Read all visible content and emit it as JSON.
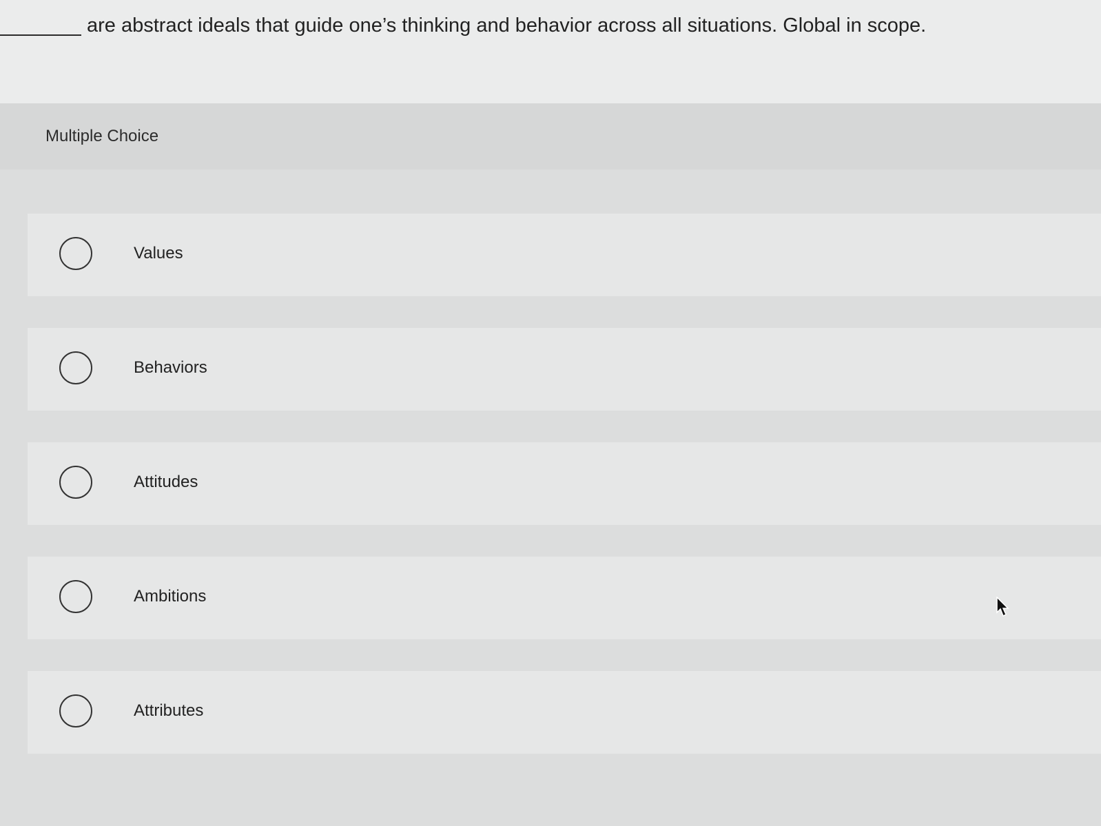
{
  "question": {
    "text": "are abstract ideals that guide one’s thinking and behavior across all situations. Global in scope."
  },
  "panel": {
    "title": "Multiple Choice"
  },
  "options": [
    {
      "label": "Values"
    },
    {
      "label": "Behaviors"
    },
    {
      "label": "Attitudes"
    },
    {
      "label": "Ambitions"
    },
    {
      "label": "Attributes"
    }
  ],
  "cursor": {
    "icon": "mouse-pointer-icon"
  }
}
